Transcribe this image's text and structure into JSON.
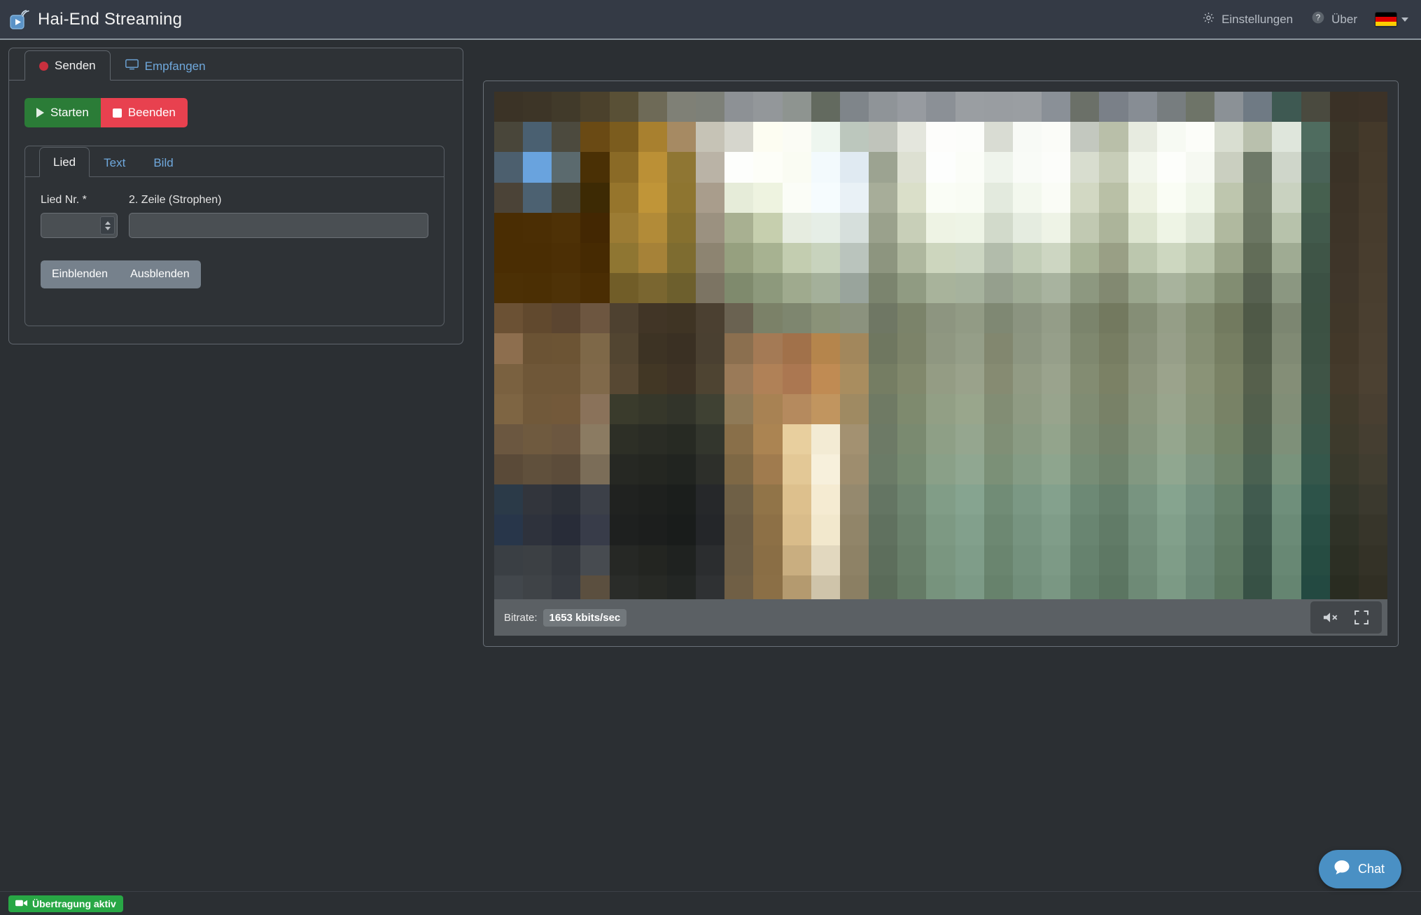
{
  "header": {
    "logo_icon": "broadcast-play-icon",
    "title": "Hai-End Streaming",
    "settings": {
      "icon": "gear-icon",
      "label": "Einstellungen"
    },
    "about": {
      "icon": "question-circle-icon",
      "label": "Über"
    },
    "language": {
      "flag": "german-flag",
      "flag_colors": [
        "#000000",
        "#dd0000",
        "#ffce00"
      ],
      "caret_icon": "chevron-down-icon"
    }
  },
  "left_panel": {
    "tabs": [
      {
        "label": "Senden",
        "icon": "record-dot-icon",
        "active": true
      },
      {
        "label": "Empfangen",
        "icon": "monitor-icon",
        "active": false
      }
    ],
    "transport": {
      "start": {
        "label": "Starten",
        "icon": "play-icon",
        "color": "#2b7c37"
      },
      "stop": {
        "label": "Beenden",
        "icon": "stop-icon",
        "color": "#e8414f"
      }
    },
    "content_card": {
      "tabs": [
        {
          "label": "Lied",
          "active": true
        },
        {
          "label": "Text",
          "active": false
        },
        {
          "label": "Bild",
          "active": false
        }
      ],
      "fields": [
        {
          "label": "Lied Nr. *",
          "value": "",
          "placeholder": "",
          "type": "number"
        },
        {
          "label": "2. Zeile (Strophen)",
          "value": "",
          "placeholder": "",
          "type": "text"
        }
      ],
      "actions": [
        {
          "label": "Einblenden"
        },
        {
          "label": "Ausblenden"
        }
      ]
    }
  },
  "player": {
    "bitrate_label": "Bitrate:",
    "bitrate_value": "1653 kbits/sec",
    "mute_icon": "speaker-muted-icon",
    "fullscreen_icon": "fullscreen-icon",
    "mosaic": {
      "columns": 31,
      "rows": 18,
      "description": "heavily pixelated live video frame of a dim interior with bright windows at top",
      "colors": [
        "#3b3326",
        "#3d3527",
        "#413a2a",
        "#4b412c",
        "#595036",
        "#6e6a57",
        "#7f8076",
        "#7d8078",
        "#8d9195",
        "#93979a",
        "#8e9490",
        "#636a5f",
        "#7f858a",
        "#8f9498",
        "#979ba0",
        "#8b9096",
        "#9a9ea2",
        "#999da1",
        "#9a9ea2",
        "#8a9097",
        "#6b7068",
        "#7a8088",
        "#878d94",
        "#777d7f",
        "#6e7468",
        "#8b9196",
        "#6f7a84",
        "#3e5952",
        "#4a4a3f",
        "#3a3126",
        "#3c3227",
        "#49463a",
        "#4a6071",
        "#4c4a3e",
        "#6a4a14",
        "#7b5c1e",
        "#a8802f",
        "#a68a63",
        "#c6c3b6",
        "#d6d6cd",
        "#fdfdf2",
        "#fbfcf5",
        "#eef6ef",
        "#bcc7bd",
        "#c0c4bb",
        "#e4e6dd",
        "#fdfdfb",
        "#fcfdfa",
        "#d9dcd3",
        "#f8faf6",
        "#fbfcf8",
        "#c3c8bf",
        "#b9bfa9",
        "#e7ebe0",
        "#f7faf3",
        "#fcfdf9",
        "#d9ded1",
        "#b9c0ad",
        "#dfe6dc",
        "#4f6c5f",
        "#3b3528",
        "#44392a",
        "#4c5f6e",
        "#69a3de",
        "#5b6a6e",
        "#4a3005",
        "#8a6a26",
        "#bb9036",
        "#8f7633",
        "#bab3a6",
        "#fdfefc",
        "#fdfef8",
        "#fafcf3",
        "#f3fafd",
        "#e0eaf2",
        "#9ca391",
        "#dde0d2",
        "#fdfefd",
        "#fbfdf8",
        "#eff4ec",
        "#f9fbf7",
        "#fcfdfa",
        "#d8ddcf",
        "#c7cdb8",
        "#f2f6ec",
        "#fdfefb",
        "#f6f9f2",
        "#caCFc0",
        "#6e7968",
        "#cfd6ca",
        "#4a6358",
        "#3a3226",
        "#453a2b",
        "#4b4337",
        "#4c6171",
        "#474435",
        "#3d2a04",
        "#96752c",
        "#c09538",
        "#8e7530",
        "#a99d8c",
        "#e6ecd9",
        "#eef3e0",
        "#fbfdf7",
        "#f6fcfe",
        "#e9f1f6",
        "#a7ad99",
        "#dadfc9",
        "#fafdf6",
        "#f9fcf4",
        "#e3eade",
        "#f3f8ee",
        "#fafcf6",
        "#d2d8c3",
        "#b9c0a6",
        "#edf2e2",
        "#fafdf5",
        "#f0f6e9",
        "#bec6ae",
        "#6f7a66",
        "#c9d2c0",
        "#46604f",
        "#3c3327",
        "#463b2c",
        "#4a2d03",
        "#4b2e04",
        "#4e3106",
        "#432702",
        "#9c7c34",
        "#b28b38",
        "#86702f",
        "#9b9180",
        "#a8b091",
        "#c6cfae",
        "#e6ece0",
        "#e6eee6",
        "#d6dfdc",
        "#9aa18c",
        "#c8cfb8",
        "#eef3e4",
        "#eef4e6",
        "#d2dacb",
        "#e5ece0",
        "#eef3e6",
        "#c1c9b2",
        "#acb49a",
        "#dde5d0",
        "#eef4e5",
        "#dfe7d6",
        "#b0b99f",
        "#6b7662",
        "#b7c2ab",
        "#425a4c",
        "#3d3428",
        "#473c2d",
        "#4a2d03",
        "#4a2d03",
        "#4c2f05",
        "#462a02",
        "#8f7632",
        "#a68238",
        "#7e6c30",
        "#8d8471",
        "#96a07f",
        "#a7b291",
        "#c3cdb0",
        "#c8d3bd",
        "#bac4bd",
        "#8d957f",
        "#aeb79e",
        "#cdd6be",
        "#ccd6c2",
        "#b2bcab",
        "#c2cdb7",
        "#cdd6c2",
        "#a9b498",
        "#999f85",
        "#bcc7ae",
        "#cdd7c0",
        "#bbc6ad",
        "#9aa489",
        "#626d58",
        "#9fab93",
        "#3f5547",
        "#3e3529",
        "#483d2e",
        "#4c3005",
        "#4b2f04",
        "#4e3207",
        "#4a2d03",
        "#715d28",
        "#7a6630",
        "#6d5f2d",
        "#7c7463",
        "#7f8a6d",
        "#8d997c",
        "#9faa8e",
        "#a4b09a",
        "#99a49c",
        "#7b846e",
        "#909b82",
        "#a8b39b",
        "#a6b29d",
        "#959f8d",
        "#9fab95",
        "#a8b39f",
        "#8d9880",
        "#828971",
        "#9aa68d",
        "#a8b39d",
        "#9aa68c",
        "#828d72",
        "#576150",
        "#8b9781",
        "#3c5144",
        "#3f362a",
        "#493e2f",
        "#6b5134",
        "#61492e",
        "#5b4530",
        "#6d5640",
        "#4e4130",
        "#413526",
        "#3f3424",
        "#4b4031",
        "#6a6251",
        "#7b8168",
        "#7e866f",
        "#8a9278",
        "#8b927e",
        "#6f7764",
        "#7b836a",
        "#8d9580",
        "#929b85",
        "#7f8873",
        "#8b9480",
        "#949d88",
        "#7b846c",
        "#73795f",
        "#858e76",
        "#959e87",
        "#838d72",
        "#727a5f",
        "#4f5947",
        "#7c8671",
        "#3c5143",
        "#403729",
        "#4a3f30",
        "#8d6e4e",
        "#6b5334",
        "#6c5434",
        "#7e6848",
        "#524531",
        "#3d3324",
        "#3a3023",
        "#4a4031",
        "#8b6f4f",
        "#a47a55",
        "#a1714a",
        "#b5854c",
        "#a2875c",
        "#6f7760",
        "#7c8369",
        "#8f9781",
        "#959e88",
        "#82876f",
        "#8d9681",
        "#969f8a",
        "#7f886f",
        "#777d62",
        "#89917a",
        "#979f89",
        "#868f74",
        "#767e62",
        "#525c49",
        "#808a74",
        "#3d5244",
        "#423829",
        "#4b4031",
        "#7a6140",
        "#6f5738",
        "#6f5738",
        "#80694a",
        "#574833",
        "#423725",
        "#3e3325",
        "#4e4432",
        "#9a7a58",
        "#b08157",
        "#ab7751",
        "#c08b53",
        "#a98d5f",
        "#757d63",
        "#81886c",
        "#949c84",
        "#9aa28b",
        "#868b72",
        "#929b84",
        "#9aa38d",
        "#838c72",
        "#7b8165",
        "#8d957d",
        "#9ba38c",
        "#8a9377",
        "#7a8265",
        "#56604c",
        "#848e77",
        "#3f5446",
        "#443a2b",
        "#4c4132",
        "#7e6543",
        "#71593a",
        "#73593a",
        "#8a725a",
        "#3a3b2c",
        "#36372a",
        "#32342a",
        "#3f4133",
        "#8f7a57",
        "#a88253",
        "#b58a5e",
        "#c1955f",
        "#9f8a62",
        "#6f7a64",
        "#7e8a6e",
        "#929f85",
        "#99a68c",
        "#828d74",
        "#8f9b83",
        "#98a48d",
        "#808c73",
        "#788167",
        "#8b977e",
        "#99a58d",
        "#879378",
        "#788266",
        "#525f4c",
        "#818e77",
        "#3c5547",
        "#403a2b",
        "#493f31",
        "#6b5740",
        "#6f5a3f",
        "#6c5740",
        "#8b7b62",
        "#2d2f26",
        "#2a2c25",
        "#272a23",
        "#33362d",
        "#896f49",
        "#ab8452",
        "#e8cf9e",
        "#f3ebd4",
        "#a39171",
        "#6d7a66",
        "#7a8a70",
        "#8e9f86",
        "#95a68f",
        "#808f76",
        "#8a9b83",
        "#93a48c",
        "#7c8c74",
        "#74826a",
        "#87977f",
        "#95a68e",
        "#83947a",
        "#748468",
        "#4f604e",
        "#7e9079",
        "#395649",
        "#3d3a2c",
        "#453e31",
        "#5a4a38",
        "#60503c",
        "#5c4c3a",
        "#7b6d58",
        "#262823",
        "#242621",
        "#212420",
        "#2d2f2a",
        "#7e6845",
        "#a07b4e",
        "#e3c896",
        "#f7f0dc",
        "#9e8d6e",
        "#6b7b67",
        "#768a71",
        "#8aa088",
        "#90a791",
        "#7b9077",
        "#859c85",
        "#8ea58e",
        "#778d76",
        "#6f836c",
        "#829881",
        "#90a790",
        "#7e9580",
        "#70856c",
        "#4a6151",
        "#79937c",
        "#35574b",
        "#39392c",
        "#413d30",
        "#2b3a48",
        "#32353c",
        "#2c3038",
        "#3c4048",
        "#202220",
        "#1e201e",
        "#1b1e1c",
        "#26282a",
        "#6f6046",
        "#917448",
        "#ddc08d",
        "#f5ebd2",
        "#95896e",
        "#647563",
        "#6f8570",
        "#819d87",
        "#86a490",
        "#718c76",
        "#7b9884",
        "#84a18d",
        "#6d8975",
        "#657f6b",
        "#789480",
        "#86a48f",
        "#74917f",
        "#66816b",
        "#415b4f",
        "#6f8f7b",
        "#2d5349",
        "#33362b",
        "#3b392e",
        "#28364a",
        "#2e323c",
        "#282c38",
        "#383c49",
        "#1e201f",
        "#1c1e1d",
        "#191c1b",
        "#242629",
        "#6b5c44",
        "#8d7046",
        "#d9bc8a",
        "#f2e8cd",
        "#918569",
        "#60715f",
        "#6b816c",
        "#7d9983",
        "#82a08c",
        "#6d8872",
        "#779480",
        "#809d89",
        "#698571",
        "#617b67",
        "#74907c",
        "#82a08b",
        "#708d7b",
        "#627d67",
        "#3d574b",
        "#6b8b77",
        "#294f45",
        "#2f3227",
        "#37352a",
        "#3a3f44",
        "#3c4044",
        "#34383e",
        "#474b50",
        "#262825",
        "#232521",
        "#1f2220",
        "#2b2d2f",
        "#6c5d45",
        "#8a6e45",
        "#c9ae80",
        "#e2d8bf",
        "#8e8266",
        "#5d6e5c",
        "#687e69",
        "#7a9680",
        "#7f9d89",
        "#6a856f",
        "#74917d",
        "#7d9a86",
        "#66826e",
        "#5e7864",
        "#718d79",
        "#7f9d88",
        "#6d8a78",
        "#5f7a64",
        "#3a5448",
        "#688874",
        "#264c42",
        "#2c2f24",
        "#343227",
        "#42474c",
        "#3f4347",
        "#373b41",
        "#5b4f3f",
        "#2a2c29",
        "#272925",
        "#232624",
        "#2f3133",
        "#705f45",
        "#8b6f46",
        "#b49a6f",
        "#cfc4aa",
        "#8b7f63",
        "#5a6b59",
        "#657b66",
        "#77937d",
        "#7c9a86",
        "#67826c",
        "#718e7a",
        "#7a9783",
        "#637f6b",
        "#5b7561",
        "#6e8a76",
        "#7c9a85",
        "#6a8775",
        "#5c7761",
        "#375145",
        "#658571",
        "#234941",
        "#292c21",
        "#312f24",
        "#3f444a",
        "#3d4145",
        "#353940",
        "#5d5140",
        "#28292a",
        "#252725",
        "#212422",
        "#2c2e30",
        "#6d5c43",
        "#876b44",
        "#ae946a",
        "#cfc4aa",
        "#887c60",
        "#576856",
        "#627863",
        "#74907a",
        "#799783",
        "#647f69",
        "#6e8b77",
        "#779480",
        "#607c68",
        "#58725e",
        "#6b8773",
        "#799782",
        "#678472",
        "#59745e",
        "#344e42",
        "#62826e",
        "#204640",
        "#26291e",
        "#2e2c21"
      ]
    }
  },
  "status": {
    "badge_icon": "video-camera-icon",
    "badge_label": "Übertragung aktiv",
    "badge_color": "#28a745"
  },
  "chat": {
    "icon": "chat-bubble-icon",
    "label": "Chat",
    "color": "#4a90c4"
  }
}
